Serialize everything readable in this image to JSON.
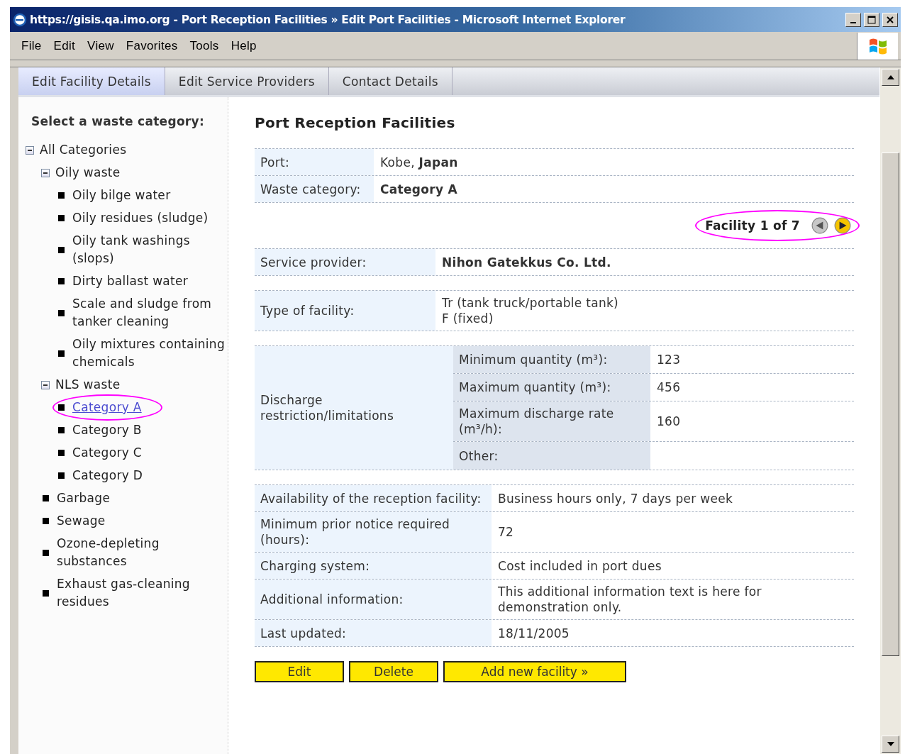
{
  "window": {
    "title": "https://gisis.qa.imo.org - Port Reception Facilities » Edit Port Facilities - Microsoft Internet Explorer"
  },
  "menu": [
    "File",
    "Edit",
    "View",
    "Favorites",
    "Tools",
    "Help"
  ],
  "tabs": [
    {
      "label": "Edit Facility Details",
      "selected": true
    },
    {
      "label": "Edit Service Providers",
      "selected": false
    },
    {
      "label": "Contact Details",
      "selected": false
    }
  ],
  "sidebar": {
    "heading": "Select a waste category:",
    "tree": [
      {
        "label": "All Categories",
        "kind": "group",
        "expanded": true,
        "selected": false,
        "highlighted": false,
        "children": [
          {
            "label": "Oily waste",
            "kind": "group",
            "expanded": true,
            "selected": false,
            "highlighted": false,
            "children": [
              {
                "label": "Oily bilge water",
                "kind": "leaf",
                "selected": false,
                "highlighted": false
              },
              {
                "label": "Oily residues (sludge)",
                "kind": "leaf",
                "selected": false,
                "highlighted": false
              },
              {
                "label": "Oily tank washings (slops)",
                "kind": "leaf",
                "selected": false,
                "highlighted": false
              },
              {
                "label": "Dirty ballast water",
                "kind": "leaf",
                "selected": false,
                "highlighted": false
              },
              {
                "label": "Scale and sludge from tanker cleaning",
                "kind": "leaf",
                "selected": false,
                "highlighted": false
              },
              {
                "label": "Oily mixtures containing chemicals",
                "kind": "leaf",
                "selected": false,
                "highlighted": false
              }
            ]
          },
          {
            "label": "NLS waste",
            "kind": "group",
            "expanded": true,
            "selected": false,
            "highlighted": false,
            "children": [
              {
                "label": "Category A",
                "kind": "leaf",
                "selected": true,
                "highlighted": true
              },
              {
                "label": "Category B",
                "kind": "leaf",
                "selected": false,
                "highlighted": false
              },
              {
                "label": "Category C",
                "kind": "leaf",
                "selected": false,
                "highlighted": false
              },
              {
                "label": "Category D",
                "kind": "leaf",
                "selected": false,
                "highlighted": false
              }
            ]
          },
          {
            "label": "Garbage",
            "kind": "leaf",
            "selected": false,
            "highlighted": false
          },
          {
            "label": "Sewage",
            "kind": "leaf",
            "selected": false,
            "highlighted": false
          },
          {
            "label": "Ozone-depleting substances",
            "kind": "leaf",
            "selected": false,
            "highlighted": false
          },
          {
            "label": "Exhaust gas-cleaning residues",
            "kind": "leaf",
            "selected": false,
            "highlighted": false
          }
        ]
      }
    ]
  },
  "main": {
    "title": "Port Reception Facilities",
    "summary": [
      {
        "label": "Port:",
        "value": "Kobe, **Japan**",
        "bold": false
      },
      {
        "label": "Waste category:",
        "value": "Category A",
        "bold": true
      }
    ],
    "pager": {
      "text": "Facility 1 of 7",
      "highlighted": true,
      "prev_disabled": true,
      "next_disabled": false
    },
    "provider": [
      {
        "label": "Service provider:",
        "value": "Nihon Gatekkus Co. Ltd.",
        "bold": true
      }
    ],
    "facility_type": [
      {
        "label": "Type of facility:",
        "value": "Tr (tank truck/portable tank)\nF (fixed)",
        "bold": false
      }
    ],
    "discharge": {
      "label": "Discharge restriction/limitations",
      "rows": [
        {
          "label": "Minimum quantity (m³):",
          "value": "123"
        },
        {
          "label": "Maximum quantity (m³):",
          "value": "456"
        },
        {
          "label": "Maximum discharge rate (m³/h):",
          "value": "160"
        },
        {
          "label": "Other:",
          "value": ""
        }
      ]
    },
    "details": [
      {
        "label": "Availability of the reception facility:",
        "value": "Business hours only, 7 days per week",
        "bold": false
      },
      {
        "label": "Minimum prior notice required (hours):",
        "value": "72",
        "bold": false
      },
      {
        "label": "Charging system:",
        "value": "Cost included in port dues",
        "bold": false
      },
      {
        "label": "Additional information:",
        "value": "This additional information text is here for demonstration only.",
        "bold": false
      },
      {
        "label": "Last updated:",
        "value": "18/11/2005",
        "bold": false
      }
    ],
    "buttons": [
      "Edit",
      "Delete",
      "Add new facility »"
    ]
  }
}
